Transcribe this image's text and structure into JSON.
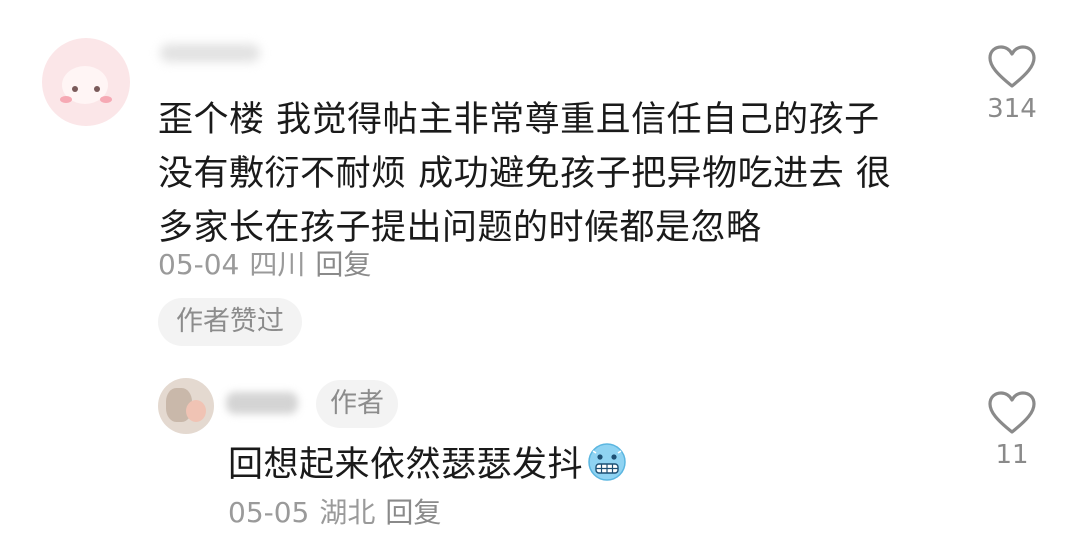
{
  "comment": {
    "text": "歪个楼 我觉得帖主非常尊重且信任自己的孩子 没有敷衍不耐烦 成功避免孩子把异物吃进去 很多家长在孩子提出问题的时候都是忽略",
    "date": "05-04",
    "location": "四川",
    "reply_label": "回复",
    "author_liked_label": "作者赞过",
    "like_count": "314",
    "like_icon": "heart-outline-icon"
  },
  "reply": {
    "author_tag": "作者",
    "text": "回想起来依然瑟瑟发抖",
    "emoji": "cold-face-emoji",
    "date": "05-05",
    "location": "湖北",
    "reply_label": "回复",
    "like_count": "11",
    "like_icon": "heart-outline-icon"
  },
  "colors": {
    "text_primary": "#1a1a1a",
    "text_secondary": "#9a9a9a",
    "tag_background": "#f3f3f3"
  }
}
